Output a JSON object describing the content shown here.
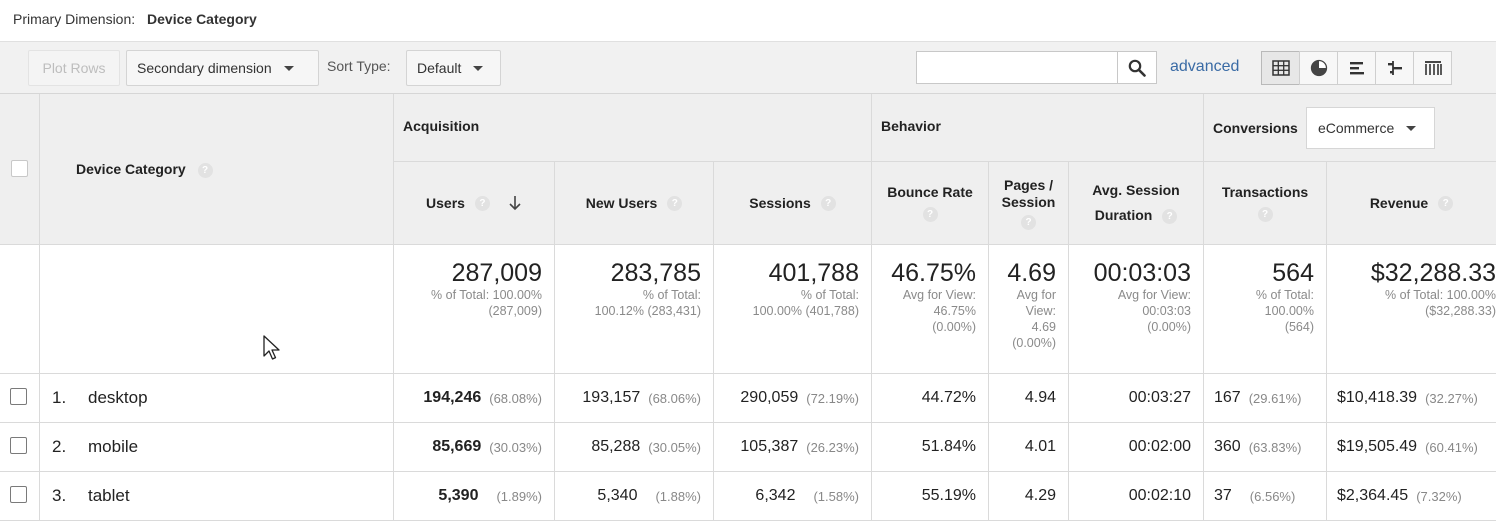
{
  "primary_dimension": {
    "label": "Primary Dimension:",
    "value": "Device Category"
  },
  "toolbar": {
    "plot_rows": "Plot Rows",
    "secondary_dimension": "Secondary dimension",
    "sort_type_label": "Sort Type:",
    "sort_type_value": "Default",
    "search_placeholder": "",
    "advanced": "advanced",
    "view_icons": [
      "table-view-icon",
      "pie-view-icon",
      "performance-view-icon",
      "comparison-view-icon",
      "pivot-view-icon"
    ]
  },
  "table": {
    "dimension_header": "Device Category",
    "groups": {
      "acquisition": "Acquisition",
      "behavior": "Behavior",
      "conversions": "Conversions",
      "conversions_select": "eCommerce"
    },
    "columns": {
      "users": "Users",
      "new_users": "New Users",
      "sessions": "Sessions",
      "bounce_rate": "Bounce Rate",
      "pages_session_1": "Pages /",
      "pages_session_2": "Session",
      "avg_duration_1": "Avg. Session",
      "avg_duration_2": "Duration",
      "transactions": "Transactions",
      "revenue": "Revenue"
    },
    "totals": {
      "users": {
        "value": "287,009",
        "lines": [
          "% of Total: 100.00%",
          "(287,009)"
        ]
      },
      "new_users": {
        "value": "283,785",
        "lines": [
          "% of Total:",
          "100.12% (283,431)"
        ]
      },
      "sessions": {
        "value": "401,788",
        "lines": [
          "% of Total:",
          "100.00% (401,788)"
        ]
      },
      "bounce_rate": {
        "value": "46.75%",
        "lines": [
          "Avg for View:",
          "46.75%",
          "(0.00%)"
        ]
      },
      "pages_session": {
        "value": "4.69",
        "lines": [
          "Avg for",
          "View:",
          "4.69",
          "(0.00%)"
        ]
      },
      "avg_duration": {
        "value": "00:03:03",
        "lines": [
          "Avg for View:",
          "00:03:03",
          "(0.00%)"
        ]
      },
      "transactions": {
        "value": "564",
        "lines": [
          "% of Total:",
          "100.00%",
          "(564)"
        ]
      },
      "revenue": {
        "value": "$32,288.33",
        "lines": [
          "% of Total: 100.00%",
          "($32,288.33)"
        ]
      }
    },
    "rows": [
      {
        "index": "1.",
        "device": "desktop",
        "users": "194,246",
        "users_pct": "(68.08%)",
        "new_users": "193,157",
        "new_users_pct": "(68.06%)",
        "sessions": "290,059",
        "sessions_pct": "(72.19%)",
        "bounce_rate": "44.72%",
        "pages_session": "4.94",
        "avg_duration": "00:03:27",
        "transactions": "167",
        "transactions_pct": "(29.61%)",
        "revenue": "$10,418.39",
        "revenue_pct": "(32.27%)"
      },
      {
        "index": "2.",
        "device": "mobile",
        "users": "85,669",
        "users_pct": "(30.03%)",
        "new_users": "85,288",
        "new_users_pct": "(30.05%)",
        "sessions": "105,387",
        "sessions_pct": "(26.23%)",
        "bounce_rate": "51.84%",
        "pages_session": "4.01",
        "avg_duration": "00:02:00",
        "transactions": "360",
        "transactions_pct": "(63.83%)",
        "revenue": "$19,505.49",
        "revenue_pct": "(60.41%)"
      },
      {
        "index": "3.",
        "device": "tablet",
        "users": "5,390",
        "users_pct": "(1.89%)",
        "new_users": "5,340",
        "new_users_pct": "(1.88%)",
        "sessions": "6,342",
        "sessions_pct": "(1.58%)",
        "bounce_rate": "55.19%",
        "pages_session": "4.29",
        "avg_duration": "00:02:10",
        "transactions": "37",
        "transactions_pct": "(6.56%)",
        "revenue": "$2,364.45",
        "revenue_pct": "(7.32%)"
      }
    ]
  },
  "colors": {
    "link": "#3a6ba5",
    "header_bg": "#efefef",
    "border": "#dadada",
    "muted": "#888888"
  }
}
